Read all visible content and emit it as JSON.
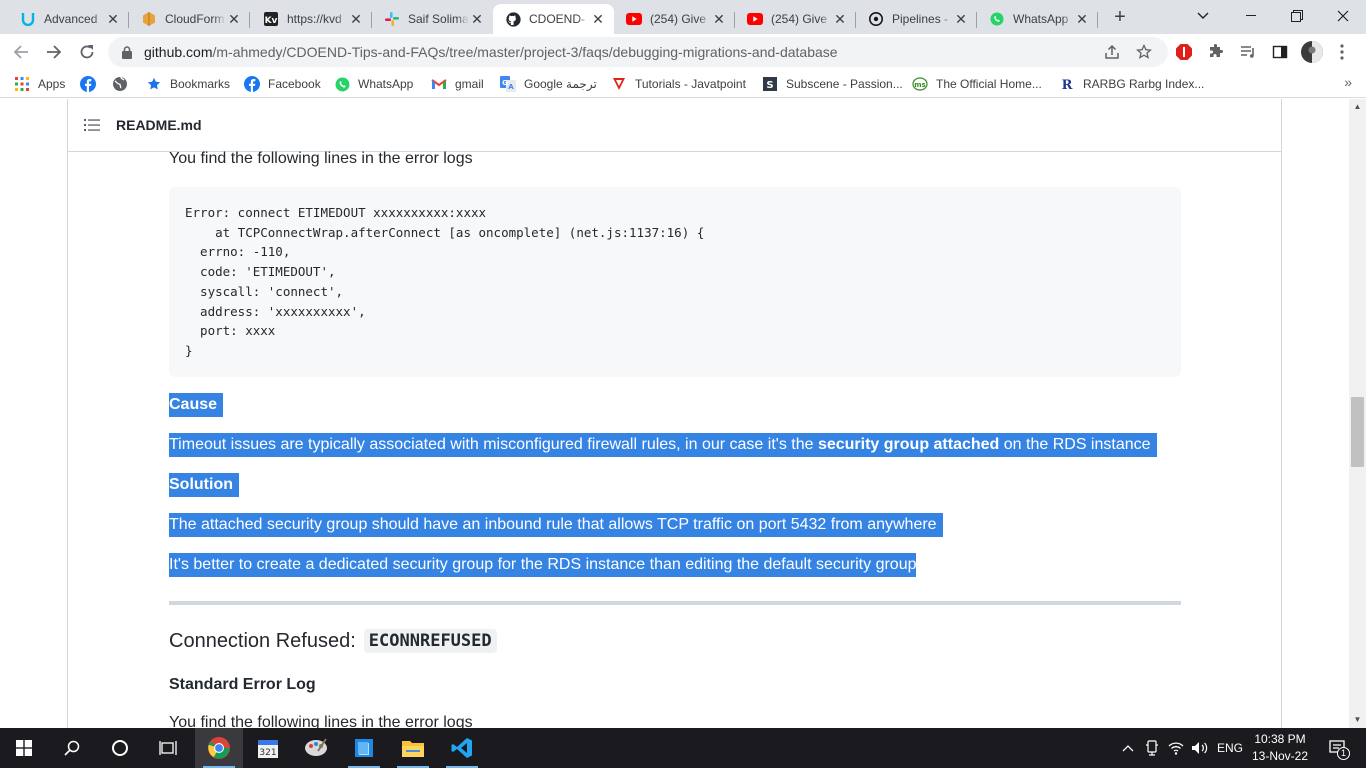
{
  "browser": {
    "tabs": [
      {
        "title": "Advanced",
        "icon": "udacity-icon",
        "color": "#02b3e4"
      },
      {
        "title": "CloudForm",
        "icon": "aws-cloudformation-icon",
        "color": "#e7a33e"
      },
      {
        "title": "https://kvd",
        "icon": "kv-icon",
        "color": "#222222"
      },
      {
        "title": "Saif Solima",
        "icon": "slack-icon",
        "color": "#e01e5a"
      },
      {
        "title": "CDOEND-",
        "icon": "github-icon",
        "color": "#24292f"
      },
      {
        "title": "(254) Give",
        "icon": "youtube-icon",
        "color": "#ff0000"
      },
      {
        "title": "(254) Give",
        "icon": "youtube-icon",
        "color": "#ff0000"
      },
      {
        "title": "Pipelines -",
        "icon": "circleci-icon",
        "color": "#161616"
      },
      {
        "title": "WhatsApp",
        "icon": "whatsapp-icon",
        "color": "#25d366"
      }
    ],
    "active_tab": 4,
    "url_host": "github.com",
    "url_path": "/m-ahmedy/CDOEND-Tips-and-FAQs/tree/master/project-3/faqs/debugging-migrations-and-database",
    "bookmarks": [
      {
        "label": "Apps",
        "icon": "apps-grid-icon"
      },
      {
        "label": "",
        "icon": "facebook-icon"
      },
      {
        "label": "",
        "icon": "globe-icon"
      },
      {
        "label": "Bookmarks",
        "icon": "star-icon"
      },
      {
        "label": "Facebook",
        "icon": "facebook-icon"
      },
      {
        "label": "WhatsApp",
        "icon": "whatsapp-icon"
      },
      {
        "label": "gmail",
        "icon": "gmail-icon"
      },
      {
        "label": "Google ترجمة",
        "icon": "google-translate-icon"
      },
      {
        "label": "Tutorials - Javatpoint",
        "icon": "javatpoint-icon"
      },
      {
        "label": "Subscene - Passion...",
        "icon": "subscene-icon"
      },
      {
        "label": "The Official Home...",
        "icon": "website-icon"
      },
      {
        "label": "RARBG Rarbg Index...",
        "icon": "rarbg-icon"
      }
    ],
    "bookmarks_more": "»"
  },
  "readme": {
    "filename": "README.md",
    "intro_line": "You find the following lines in the error logs",
    "code_lines": [
      "Error: connect ETIMEDOUT xxxxxxxxxx:xxxx",
      "    at TCPConnectWrap.afterConnect [as oncomplete] (net.js:1137:16) {",
      "  errno: -110,",
      "  code: 'ETIMEDOUT',",
      "  syscall: 'connect',",
      "  address: 'xxxxxxxxxx',",
      "  port: xxxx",
      "}"
    ],
    "cause_heading": "Cause",
    "cause_pre": "Timeout issues are typically associated with misconfigured firewall rules, in our case it's the ",
    "cause_bold": "security group attached",
    "cause_post": " on the RDS instance",
    "solution_heading": "Solution",
    "solution_line1": "The attached security group should have an inbound rule that allows TCP traffic on port 5432 from anywhere",
    "solution_line2": "It's better to create a dedicated security group for the RDS instance than editing the default security group",
    "section2_title": "Connection Refused:",
    "section2_code": "ECONNREFUSED",
    "section2_subheading": "Standard Error Log",
    "section2_intro": "You find the following lines in the error logs"
  },
  "taskbar": {
    "language": "ENG",
    "time": "10:38 PM",
    "date": "13-Nov-22",
    "notification_count": "1"
  },
  "colors": {
    "selection": "#3584e4",
    "code_bg": "#f6f8fa",
    "text": "#24292f"
  }
}
